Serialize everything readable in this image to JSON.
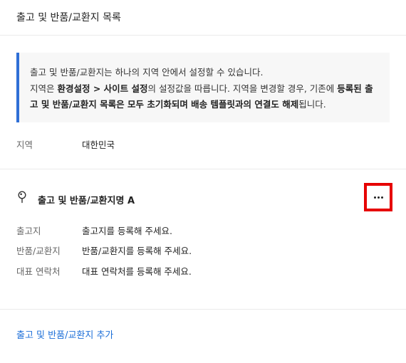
{
  "header": {
    "title": "출고 및 반품/교환지 목록"
  },
  "notice": {
    "line1": "출고 및 반품/교환지는 하나의 지역 안에서 설정할 수 있습니다.",
    "line2_prefix": "지역은 ",
    "line2_bold_path": "환경설정 > 사이트 설정",
    "line2_middle": "의 설정값을 따릅니다. 지역을 변경할 경우, 기존에 ",
    "line2_bold_warning": "등록된 출고 및 반품/교환지 목록은 모두 초기화되며 배송 템플릿과의 연결도 해제",
    "line2_suffix": "됩니다."
  },
  "region": {
    "label": "지역",
    "value": "대한민국"
  },
  "location": {
    "title": "출고 및 반품/교환지명 A",
    "icon": "pin-icon",
    "more_icon": "more-horizontal-icon",
    "rows": [
      {
        "label": "출고지",
        "value": "출고지를 등록해 주세요."
      },
      {
        "label": "반품/교환지",
        "value": "반품/교환지를 등록해 주세요."
      },
      {
        "label": "대표 연락처",
        "value": "대표 연락처를 등록해 주세요."
      }
    ]
  },
  "add_link": {
    "label": "출고 및 반품/교환지 추가"
  },
  "colors": {
    "accent": "#1d6fd8",
    "notice_bar": "#2f6fd6",
    "highlight": "#e60000"
  }
}
